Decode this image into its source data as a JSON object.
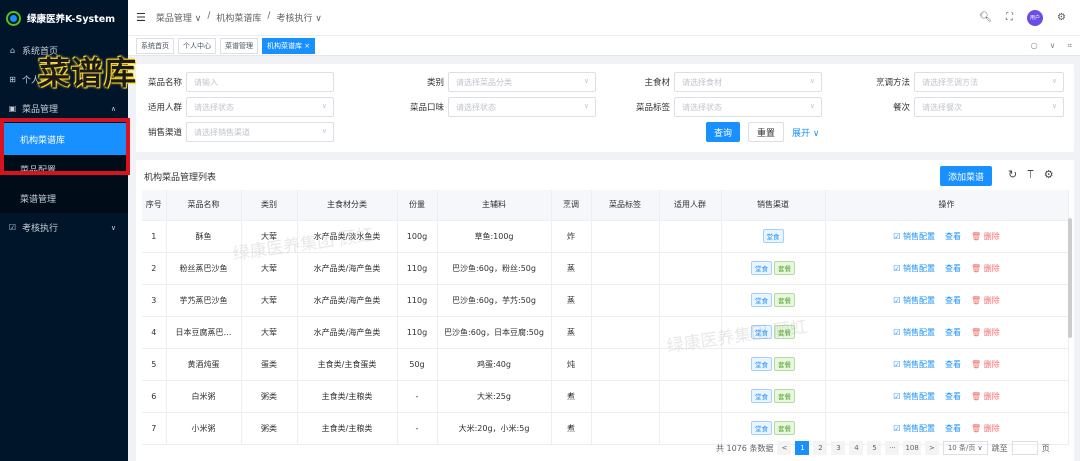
{
  "app": {
    "title": "绿康医养K-System"
  },
  "sidebar": {
    "items": [
      {
        "label": "系统首页",
        "icon": "home-icon"
      },
      {
        "label": "个人中心",
        "icon": "grid-icon"
      },
      {
        "label": "菜品管理",
        "icon": "box-icon"
      }
    ],
    "sub_items": [
      "机构菜谱库",
      "菜品配置",
      "菜谱管理"
    ],
    "exec": "考核执行"
  },
  "overlay_text": "菜谱库",
  "topbar": {
    "crumbs": [
      "菜品管理 ∨",
      "/",
      "机构菜谱库",
      "/",
      "考核执行 ∨"
    ],
    "avatar": "用户"
  },
  "tabs": [
    "系统首页",
    "个人中心",
    "菜谱管理",
    "机构菜谱库 ×"
  ],
  "filters": {
    "row1": [
      {
        "label": "菜品名称",
        "placeholder": "请输入"
      },
      {
        "label": "类别",
        "placeholder": "请选择菜品分类"
      },
      {
        "label": "主食材",
        "placeholder": "请选择食材"
      },
      {
        "label": "烹调方法",
        "placeholder": "请选择烹调方法"
      }
    ],
    "row2": [
      {
        "label": "适用人群",
        "placeholder": "请选择状态"
      },
      {
        "label": "菜品口味",
        "placeholder": "请选择状态"
      },
      {
        "label": "菜品标签",
        "placeholder": "请选择状态"
      },
      {
        "label": "餐次",
        "placeholder": "请选择餐次"
      }
    ],
    "row3": [
      {
        "label": "销售渠道",
        "placeholder": "请选择销售渠道"
      }
    ],
    "query": "查询",
    "reset": "重置",
    "expand": "展开 ∨"
  },
  "table": {
    "title": "机构菜品管理列表",
    "add": "添加菜谱",
    "headers": [
      "序号",
      "菜品名称",
      "类别",
      "主食材分类",
      "份量",
      "主辅料",
      "烹调",
      "菜品标签",
      "适用人群",
      "销售渠道",
      "操作"
    ],
    "rows": [
      {
        "no": "1",
        "name": "酥鱼",
        "cat": "大荤",
        "main": "水产品类/淡水鱼类",
        "qty": "100g",
        "ing": "草鱼:100g",
        "cook": "炸",
        "tags": "",
        "crowd": "",
        "ch": [
          "堂食"
        ]
      },
      {
        "no": "2",
        "name": "粉丝蒸巴沙鱼",
        "cat": "大荤",
        "main": "水产品类/海产鱼类",
        "qty": "110g",
        "ing": "巴沙鱼:60g，粉丝:50g",
        "cook": "蒸",
        "tags": "",
        "crowd": "",
        "ch": [
          "堂食",
          "套餐"
        ]
      },
      {
        "no": "3",
        "name": "芋艿蒸巴沙鱼",
        "cat": "大荤",
        "main": "水产品类/海产鱼类",
        "qty": "110g",
        "ing": "巴沙鱼:60g，芋艿:50g",
        "cook": "蒸",
        "tags": "",
        "crowd": "",
        "ch": [
          "堂食",
          "套餐"
        ]
      },
      {
        "no": "4",
        "name": "日本豆腐蒸巴…",
        "cat": "大荤",
        "main": "水产品类/海产鱼类",
        "qty": "110g",
        "ing": "巴沙鱼:60g，日本豆腐:50g",
        "cook": "蒸",
        "tags": "",
        "crowd": "",
        "ch": [
          "堂食",
          "套餐"
        ]
      },
      {
        "no": "5",
        "name": "黄酒炖蛋",
        "cat": "蛋类",
        "main": "主食类/主食蛋类",
        "qty": "50g",
        "ing": "鸡蛋:40g",
        "cook": "炖",
        "tags": "",
        "crowd": "",
        "ch": [
          "堂食",
          "套餐"
        ]
      },
      {
        "no": "6",
        "name": "白米粥",
        "cat": "粥类",
        "main": "主食类/主粮类",
        "qty": "-",
        "ing": "大米:25g",
        "cook": "煮",
        "tags": "",
        "crowd": "",
        "ch": [
          "堂食",
          "套餐"
        ]
      },
      {
        "no": "7",
        "name": "小米粥",
        "cat": "粥类",
        "main": "主食类/主粮类",
        "qty": "-",
        "ing": "大米:20g，小米:5g",
        "cook": "煮",
        "tags": "",
        "crowd": "",
        "ch": [
          "堂食",
          "套餐"
        ]
      }
    ],
    "ops": {
      "config": "☑ 销售配置",
      "view": "查看",
      "del": "🗑 删除"
    }
  },
  "pager": {
    "total": "共 1076 条数据",
    "pages": [
      "1",
      "2",
      "3",
      "4",
      "5",
      "···",
      "108"
    ],
    "prev": "<",
    "next": ">",
    "size": "10 条/页 ∨",
    "goto": "跳至",
    "page_unit": "页"
  },
  "watermark": "绿康医养集团 顾虹"
}
